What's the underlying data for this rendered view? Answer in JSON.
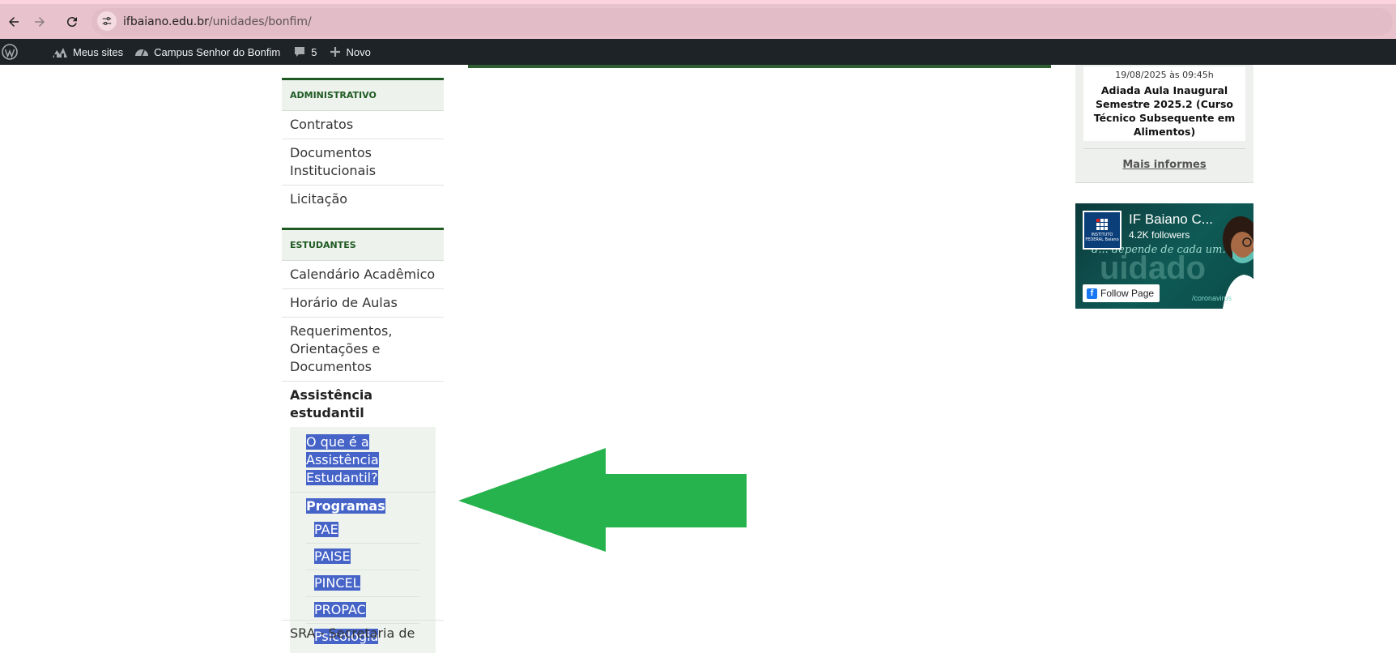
{
  "browser": {
    "url_host": "ifbaiano.edu.br",
    "url_path": "/unidades/bonfim/"
  },
  "adminbar": {
    "my_sites": "Meus sites",
    "site_name": "Campus Senhor do Bonfim",
    "comments_count": "5",
    "new_label": "Novo"
  },
  "sidebar": {
    "admin_heading": "ADMINISTRATIVO",
    "admin_items": [
      "Contratos",
      "Documentos Institucionais",
      "Licitação"
    ],
    "students_heading": "ESTUDANTES",
    "student_items": [
      "Calendário Acadêmico",
      "Horário de Aulas",
      "Requerimentos, Orientações e Documentos"
    ],
    "assistance": {
      "label": "Assistência estudantil",
      "what_is": [
        "O que é a",
        "Assistência",
        "Estudantil?"
      ],
      "programs_label": "Programas",
      "programs": [
        "PAE",
        "PAISE",
        "PINCEL",
        "PROPAC",
        "Psicologia"
      ]
    },
    "next_item": "SRA - Secretaria de"
  },
  "news": {
    "date": "19/08/2025 às 09:45h",
    "title": "Adiada Aula Inaugural Semestre 2025.2 (Curso Técnico Subsequente em Alimentos)",
    "more_link": "Mais informes"
  },
  "facebook": {
    "page_name": "IF Baiano C...",
    "followers": "4.2K followers",
    "slogan": "d... depende de cada um.",
    "big_word": "uidado",
    "follow_label": "Follow Page",
    "url_fragment": "/coronavirus",
    "logo_text": "INSTITUTO FEDERAL Baiano"
  },
  "colors": {
    "arrow": "#26b24c",
    "selection": "#4664c8",
    "section_accent": "#1f5a22"
  }
}
